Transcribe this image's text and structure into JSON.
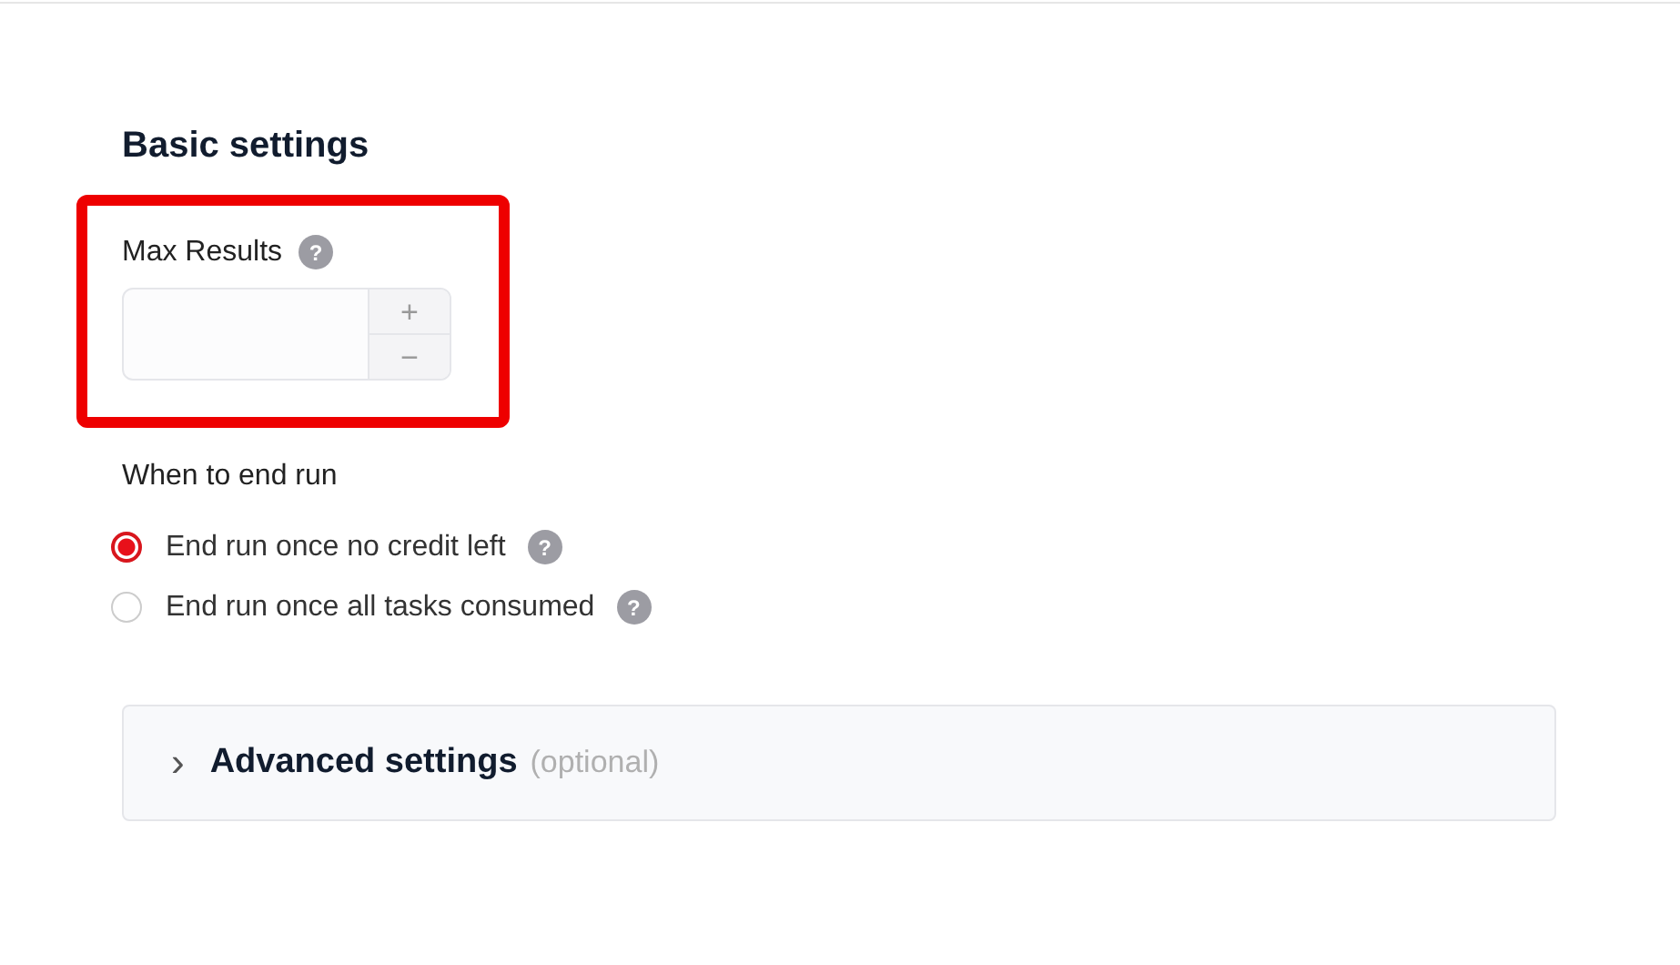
{
  "section_title": "Basic settings",
  "max_results": {
    "label": "Max Results",
    "help": "?",
    "increment": "+",
    "decrement": "−",
    "highlighted": true
  },
  "end_run": {
    "label": "When to end run",
    "options": [
      {
        "label": "End run once no credit left",
        "help": "?",
        "selected": true
      },
      {
        "label": "End run once all tasks consumed",
        "help": "?",
        "selected": false
      }
    ]
  },
  "advanced": {
    "chevron": "›",
    "title": "Advanced settings",
    "note": "(optional)",
    "expanded": false
  }
}
